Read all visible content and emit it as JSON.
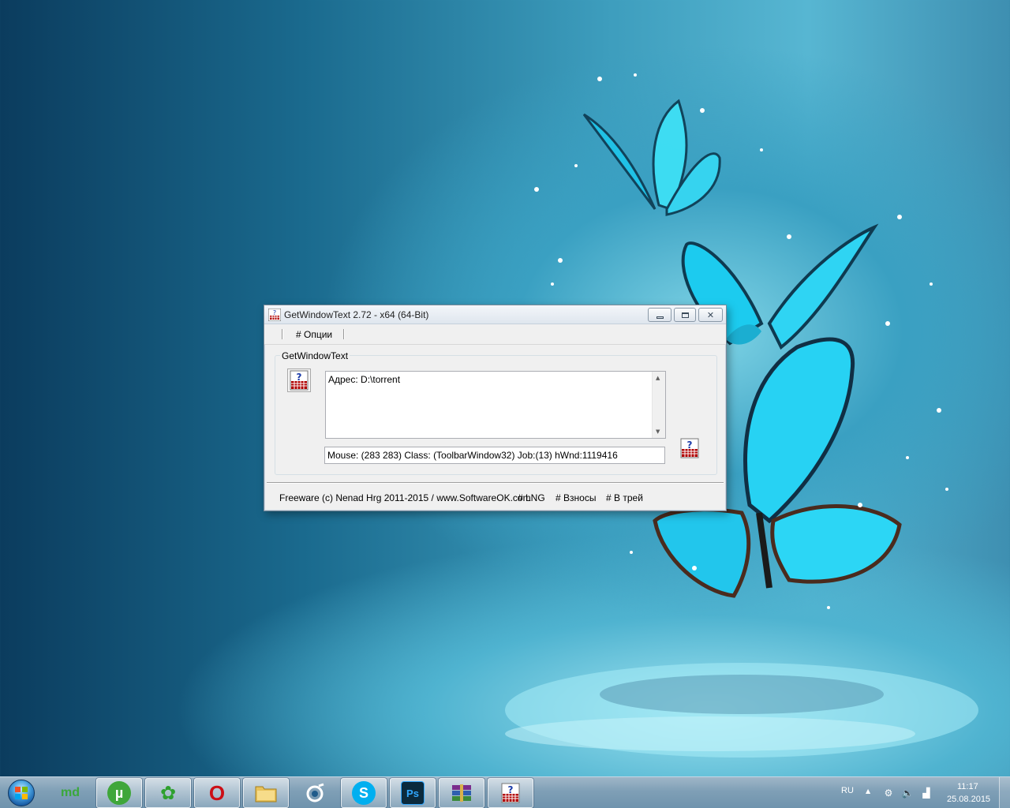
{
  "window": {
    "title": "GetWindowText 2.72 - x64 (64-Bit)",
    "menu_options": "# Опции",
    "group_label": "GetWindowText",
    "text_content": "Адрес: D:\\torrent",
    "status": "Mouse: (283 283) Class: (ToolbarWindow32) Job:(13) hWnd:1119416",
    "footer": {
      "copyright": "Freeware (c) Nenad Hrg 2011-2015 / www.SoftwareOK.com",
      "lng": "# LNG",
      "donate": "# Взносы",
      "tray": "# В трей"
    }
  },
  "taskbar": {
    "items": [
      {
        "name": "mydefrag",
        "label": "md"
      },
      {
        "name": "utorrent",
        "label": "µ"
      },
      {
        "name": "icq",
        "label": "✿"
      },
      {
        "name": "opera",
        "label": "O"
      },
      {
        "name": "explorer",
        "label": ""
      },
      {
        "name": "app-eye",
        "label": ""
      },
      {
        "name": "skype",
        "label": "S"
      },
      {
        "name": "photoshop",
        "label": "Ps"
      },
      {
        "name": "winrar",
        "label": ""
      },
      {
        "name": "getwindowtext",
        "label": ""
      }
    ],
    "tray": {
      "language": "RU",
      "time": "11:17",
      "date": "25.08.2015"
    }
  },
  "colors": {
    "utorrent": "#3fa63a",
    "icq": "#2e8c2e",
    "opera": "#cc0f16",
    "skype": "#00aff0",
    "photoshop": "#0b2a3d"
  }
}
